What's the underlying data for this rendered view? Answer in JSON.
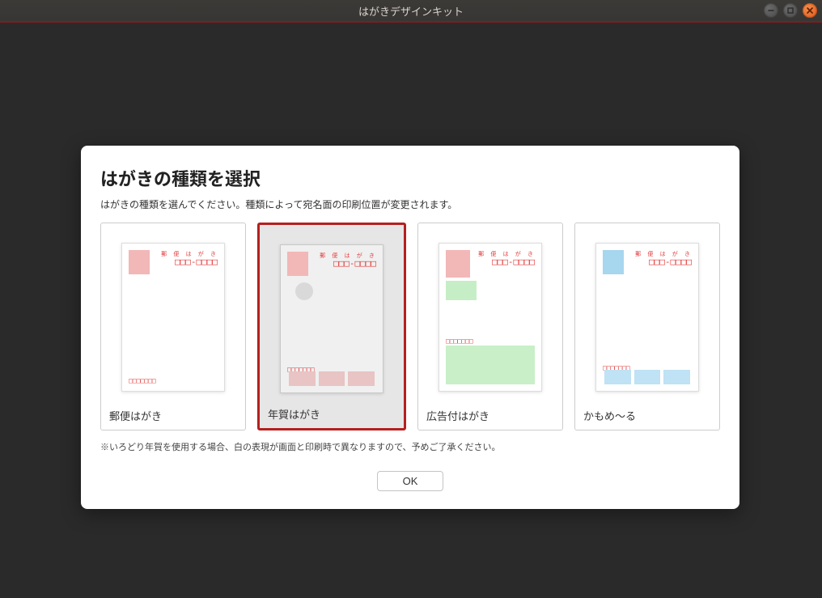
{
  "window": {
    "title": "はがきデザインキット"
  },
  "dialog": {
    "heading": "はがきの種類を選択",
    "subtitle": "はがきの種類を選んでください。種類によって宛名面の印刷位置が変更されます。",
    "footnote": "※いろどり年賀を使用する場合、白の表現が画面と印刷時で異なりますので、予めご了承ください。",
    "ok_label": "OK",
    "selected_index": 1,
    "cards": [
      {
        "label": "郵便はがき"
      },
      {
        "label": "年賀はがき"
      },
      {
        "label": "広告付はがき"
      },
      {
        "label": "かもめ〜る"
      }
    ]
  },
  "postcard_hints": {
    "zip_tiny": "郵 便 は が き",
    "zip_boxes": "□□□-□□□□",
    "sender_boxes": "□□□□□□□"
  }
}
